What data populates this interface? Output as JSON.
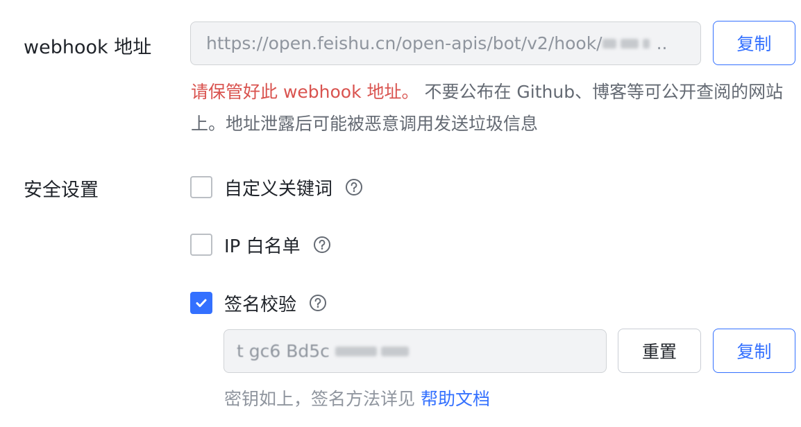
{
  "webhook": {
    "label": "webhook 地址",
    "url_display": "https://open.feishu.cn/open-apis/bot/v2/hook/",
    "ellipsis": "..",
    "copy_label": "复制",
    "warning_danger": "请保管好此 webhook 地址。",
    "warning_rest": " 不要公布在 Github、博客等可公开查阅的网站上。地址泄露后可能被恶意调用发送垃圾信息"
  },
  "security": {
    "label": "安全设置",
    "options": [
      {
        "label": "自定义关键词",
        "checked": false
      },
      {
        "label": "IP 白名单",
        "checked": false
      },
      {
        "label": "签名校验",
        "checked": true
      }
    ],
    "secret": {
      "value_display": "t gc6 Bd5c",
      "reset_label": "重置",
      "copy_label": "复制",
      "hint_text": "密钥如上，签名方法详见 ",
      "hint_link": "帮助文档"
    }
  },
  "colors": {
    "accent": "#3370ff",
    "danger": "#d9534f",
    "muted": "#8f959e"
  }
}
